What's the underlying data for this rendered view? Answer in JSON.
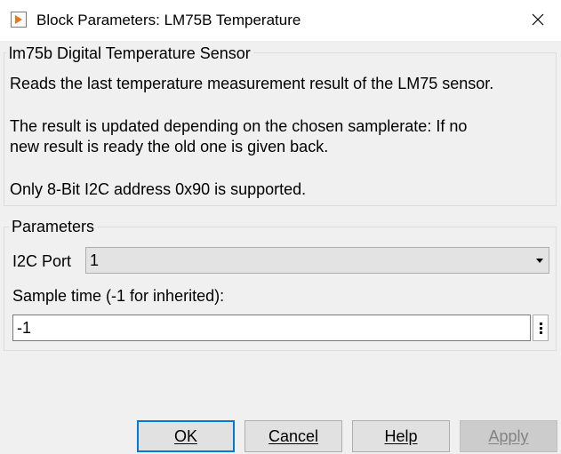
{
  "window": {
    "title": "Block Parameters: LM75B Temperature",
    "icon": "simulink-block-icon",
    "close_icon": "close-icon"
  },
  "description": {
    "title": "lm75b Digital Temperature Sensor",
    "lines": [
      "Reads the last temperature measurement result of the LM75 sensor.",
      "The result is updated depending on the chosen samplerate: If no",
      "new result is ready the old one is given back.",
      "Only 8-Bit I2C address 0x90 is supported."
    ]
  },
  "parameters": {
    "title": "Parameters",
    "i2c_port": {
      "label": "I2C Port",
      "value": "1"
    },
    "sample_time": {
      "label": "Sample time (-1 for inherited):",
      "value": "-1"
    }
  },
  "buttons": {
    "ok": "OK",
    "cancel": "Cancel",
    "help": "Help",
    "apply": "Apply"
  },
  "colors": {
    "default_button_border": "#0078d7",
    "dialog_background": "#f0f0f0",
    "icon_accent": "#e4761e"
  }
}
